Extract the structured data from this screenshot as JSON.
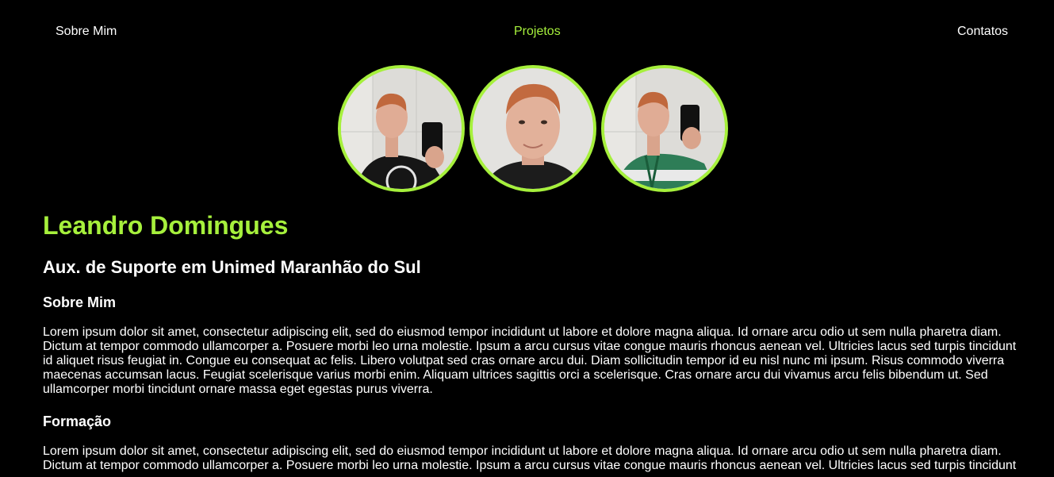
{
  "nav": {
    "items": [
      {
        "label": "Sobre Mim",
        "active": false
      },
      {
        "label": "Projetos",
        "active": true
      },
      {
        "label": "Contatos",
        "active": false
      }
    ]
  },
  "colors": {
    "accent": "#a6f03c",
    "background": "#000000",
    "text": "#ffffff"
  },
  "profile": {
    "name": "Leandro Domingues",
    "role": "Aux. de Suporte em Unimed Maranhão do Sul"
  },
  "sections": [
    {
      "title": "Sobre Mim",
      "text": "Lorem ipsum dolor sit amet, consectetur adipiscing elit, sed do eiusmod tempor incididunt ut labore et dolore magna aliqua. Id ornare arcu odio ut sem nulla pharetra diam. Dictum at tempor commodo ullamcorper a. Posuere morbi leo urna molestie. Ipsum a arcu cursus vitae congue mauris rhoncus aenean vel. Ultricies lacus sed turpis tincidunt id aliquet risus feugiat in. Congue eu consequat ac felis. Libero volutpat sed cras ornare arcu dui. Diam sollicitudin tempor id eu nisl nunc mi ipsum. Risus commodo viverra maecenas accumsan lacus. Feugiat scelerisque varius morbi enim. Aliquam ultrices sagittis orci a scelerisque. Cras ornare arcu dui vivamus arcu felis bibendum ut. Sed ullamcorper morbi tincidunt ornare massa eget egestas purus viverra."
    },
    {
      "title": "Formação",
      "text": "Lorem ipsum dolor sit amet, consectetur adipiscing elit, sed do eiusmod tempor incididunt ut labore et dolore magna aliqua. Id ornare arcu odio ut sem nulla pharetra diam. Dictum at tempor commodo ullamcorper a. Posuere morbi leo urna molestie. Ipsum a arcu cursus vitae congue mauris rhoncus aenean vel. Ultricies lacus sed turpis tincidunt"
    }
  ]
}
